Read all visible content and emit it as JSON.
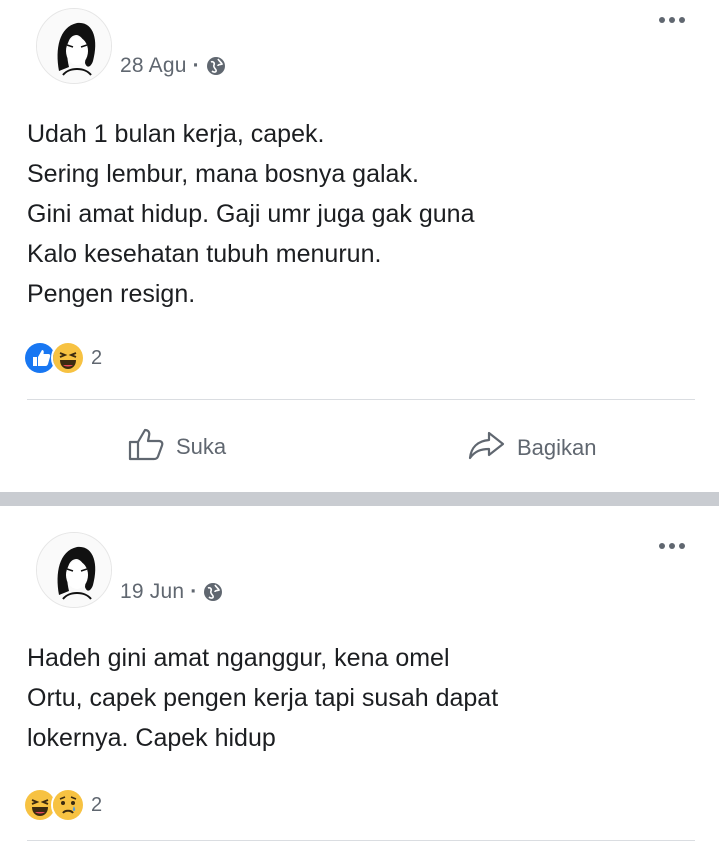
{
  "posts": [
    {
      "date": "28 Agu",
      "separator": "·",
      "lines": "Udah 1 bulan kerja, capek.\nSering lembur, mana bosnya galak.\nGini amat hidup. Gaji umr juga gak guna\nKalo kesehatan tubuh menurun.\nPengen resign.",
      "reactions": [
        "like-reaction",
        "haha-reaction"
      ],
      "reaction_count": "2",
      "actions": {
        "like_label": "Suka",
        "share_label": "Bagikan"
      }
    },
    {
      "date": "19 Jun",
      "separator": "·",
      "lines": "Hadeh gini amat nganggur, kena omel\nOrtu, capek pengen kerja tapi susah dapat\nlokernya. Capek hidup",
      "reactions": [
        "haha-reaction",
        "sad-reaction"
      ],
      "reaction_count": "2"
    }
  ],
  "icons": {
    "privacy": "globe-icon",
    "more": "more-options-icon",
    "like_action": "thumbs-up-outline-icon",
    "share_action": "share-arrow-icon"
  },
  "colors": {
    "like_blue": "#1877f2",
    "reaction_yellow": "#f7c242",
    "meta_gray": "#606770",
    "divider_band": "#c9ccd1"
  }
}
